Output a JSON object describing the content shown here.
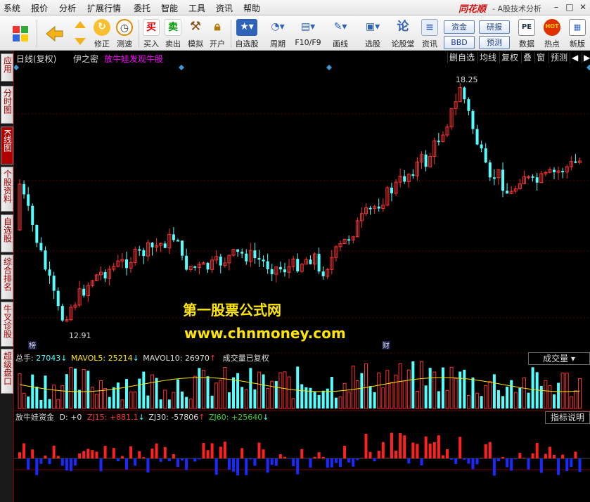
{
  "menu": [
    "系统",
    "报价",
    "分析",
    "扩展行情",
    "委托",
    "智能",
    "工具",
    "资讯",
    "帮助"
  ],
  "brand": "同花顺",
  "app_title": "- A股技术分析",
  "toolbar": {
    "buttons": [
      {
        "label": "修正"
      },
      {
        "label": "测速"
      },
      {
        "label": "买入"
      },
      {
        "label": "卖出"
      },
      {
        "label": "模拟"
      },
      {
        "label": "开户"
      },
      {
        "label": "自选股"
      },
      {
        "label": "周期"
      },
      {
        "label": "F10/F9"
      },
      {
        "label": "画线"
      },
      {
        "label": "选股"
      },
      {
        "label": "论股堂"
      },
      {
        "label": "资讯"
      },
      {
        "label": "数据"
      },
      {
        "label": "热点"
      },
      {
        "label": "新版"
      }
    ],
    "pills": [
      "资金",
      "研报",
      "BBD",
      "预测"
    ],
    "icon_text": {
      "buy": "买",
      "sell": "卖",
      "rank": "论",
      "data": "PE",
      "hot": "HOT"
    }
  },
  "side_tabs": [
    "应用",
    "分时图",
    "K线图",
    "个股资料",
    "自选股",
    "综合排名",
    "牛叉诊股",
    "超级盘口"
  ],
  "chart_header": {
    "period": "日线(复权)",
    "stock": "伊之密",
    "indicator_title": "放牛娃发现牛股",
    "buttons": [
      "删自选",
      "均线",
      "复权",
      "叠",
      "窗",
      "预测"
    ]
  },
  "price_panel": {
    "high_label": "18.25",
    "low_label": "12.91",
    "marker_left": "榜",
    "marker_right": "财"
  },
  "volume_panel": {
    "total_label": "总手:",
    "total_value": "27043",
    "ma5_label": "MAVOL5:",
    "ma5_value": "25214",
    "ma10_label": "MAVOL10:",
    "ma10_value": "26970",
    "note": "成交量已复权",
    "button": "成交量"
  },
  "capital_panel": {
    "title": "放牛娃资金",
    "d_label": "D:",
    "d_value": "+0",
    "zj15_label": "ZJ15:",
    "zj15_value": "+881.1",
    "zj30_label": "ZJ30:",
    "zj30_value": "-57806",
    "zj60_label": "ZJ60:",
    "zj60_value": "+25640",
    "button": "指标说明"
  },
  "watermark": {
    "line1": "第一股票公式网",
    "line2": "www.chnmoney.com"
  },
  "colors": {
    "up": "#ff3232",
    "down": "#54ffff",
    "yellow": "#ffe600",
    "magenta": "#ff00ff",
    "blue": "#0000ff"
  }
}
